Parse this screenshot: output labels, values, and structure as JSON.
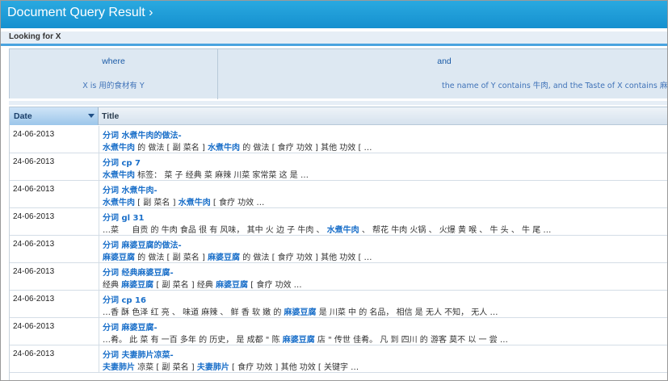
{
  "window": {
    "title": "Document Query Result ›"
  },
  "query": {
    "looking_for": "Looking for X",
    "where_label": "where",
    "where_text": "X is 用的食材有 Y",
    "and_label": "and",
    "and_text": "the name of Y contains 牛肉, and the Taste of X contains 麻辣"
  },
  "table": {
    "columns": [
      "Date",
      "Title"
    ],
    "rows": [
      {
        "date": "24-06-2013",
        "title": "分词 水煮牛肉的做法-",
        "snippet_html": "<b>水煮牛肉</b> 的 做法 [ 副 菜名 ] <b>水煮牛肉</b> 的 做法 [ 食疗 功效 ] 其他 功效 [ …"
      },
      {
        "date": "24-06-2013",
        "title": "分词 cp 7",
        "snippet_html": "<b>水煮牛肉</b> 标签： 菜 子 经典 菜 麻辣 川菜 家常菜 这 是 …"
      },
      {
        "date": "24-06-2013",
        "title": "分词 水煮牛肉-",
        "snippet_html": "<b>水煮牛肉</b> [ 副 菜名 ] <b>水煮牛肉</b> [ 食疗 功效 …"
      },
      {
        "date": "24-06-2013",
        "title": "分词 gl 31",
        "snippet_html": "…菜 　 自贡 的 牛肉 食品 很 有 风味， 其中 火 边 子 牛肉 、 <b>水煮牛肉</b> 、 帮花 牛肉 火锅 、 火爆 黄 喉 、 牛 头 、 牛 尾 …"
      },
      {
        "date": "24-06-2013",
        "title": "分词 麻婆豆腐的做法-",
        "snippet_html": "<b>麻婆豆腐</b> 的 做法 [ 副 菜名 ] <b>麻婆豆腐</b> 的 做法 [ 食疗 功效 ] 其他 功效 [ …"
      },
      {
        "date": "24-06-2013",
        "title": "分词 经典麻婆豆腐-",
        "snippet_html": "经典 <b>麻婆豆腐</b> [ 副 菜名 ] 经典 <b>麻婆豆腐</b> [ 食疗 功效 …"
      },
      {
        "date": "24-06-2013",
        "title": "分词 cp 16",
        "snippet_html": "…香 酥 色泽 红 亮 、 味道 麻辣 、 鲜 香 软 嫩 的 <b>麻婆豆腐</b> 是 川菜 中 的 名品， 相信 是 无人 不知， 无人 …"
      },
      {
        "date": "24-06-2013",
        "title": "分词 麻婆豆腐-",
        "snippet_html": "…肴。 此 菜 有 一百 多年 的 历史， 是 成都 \" 陈 <b>麻婆豆腐</b> 店 \" 传世 佳肴。 凡 到 四川 的 游客 莫不 以 一 尝 …"
      },
      {
        "date": "24-06-2013",
        "title": "分词 夫妻肺片凉菜-",
        "snippet_html": "<b>夫妻肺片</b> 凉菜 [ 副 菜名 ] <b>夫妻肺片</b> [ 食疗 功效 ] 其他 功效 [ 关键字 …"
      }
    ]
  },
  "colors": {
    "header_blue": "#1590cf",
    "link_blue": "#1a6fc9",
    "accent": "#4aa4df"
  }
}
